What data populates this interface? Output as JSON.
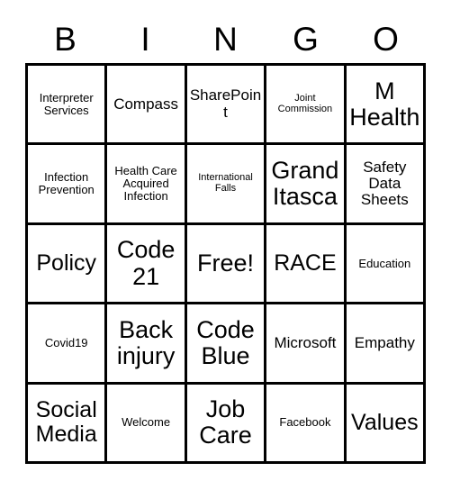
{
  "header": {
    "letters": [
      "B",
      "I",
      "N",
      "G",
      "O"
    ]
  },
  "grid": {
    "rows": [
      [
        {
          "label": "Interpreter Services",
          "size": "sm"
        },
        {
          "label": "Compass",
          "size": "md"
        },
        {
          "label": "SharePoint",
          "size": "md"
        },
        {
          "label": "Joint Commission",
          "size": "xs"
        },
        {
          "label": "M Health",
          "size": "xl"
        }
      ],
      [
        {
          "label": "Infection Prevention",
          "size": "sm"
        },
        {
          "label": "Health Care Acquired Infection",
          "size": "sm"
        },
        {
          "label": "International Falls",
          "size": "xs"
        },
        {
          "label": "Grand Itasca",
          "size": "xl"
        },
        {
          "label": "Safety Data Sheets",
          "size": "md"
        }
      ],
      [
        {
          "label": "Policy",
          "size": "lg"
        },
        {
          "label": "Code 21",
          "size": "xl"
        },
        {
          "label": "Free!",
          "size": "xl"
        },
        {
          "label": "RACE",
          "size": "lg"
        },
        {
          "label": "Education",
          "size": "sm"
        }
      ],
      [
        {
          "label": "Covid19",
          "size": "sm"
        },
        {
          "label": "Back injury",
          "size": "xl"
        },
        {
          "label": "Code Blue",
          "size": "xl"
        },
        {
          "label": "Microsoft",
          "size": "md"
        },
        {
          "label": "Empathy",
          "size": "md"
        }
      ],
      [
        {
          "label": "Social Media",
          "size": "lg"
        },
        {
          "label": "Welcome",
          "size": "sm"
        },
        {
          "label": "Job Care",
          "size": "xl"
        },
        {
          "label": "Facebook",
          "size": "sm"
        },
        {
          "label": "Values",
          "size": "lg"
        }
      ]
    ]
  },
  "colors": {
    "background": "#ffffff",
    "border": "#000000",
    "text": "#000000"
  }
}
